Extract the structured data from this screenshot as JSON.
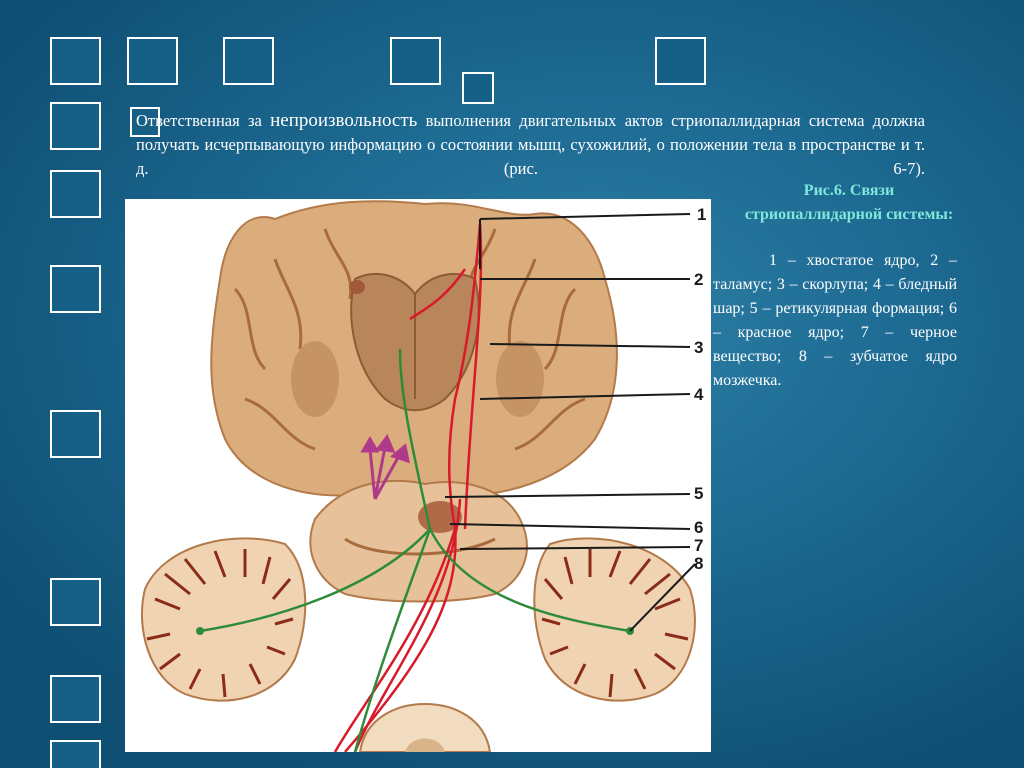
{
  "slide": {
    "paragraph": {
      "part1": "Ответственная за ",
      "emphasis": "непроизвольность",
      "part2": " выполнения двигательных актов стриопаллидарная система должна получать исчерпывающую информацию о состоянии мышц, сухожилий, о положении тела в пространстве и т. д. (рис. 6-7)."
    },
    "caption": {
      "title": "Рис.6. Связи стриопаллидарной системы:",
      "body": "1 – хвостатое ядро, 2 – таламус; 3 – скорлупа; 4 – бледный шар; 5 – ретикулярная формация; 6 – красное ядро; 7 – черное вещество; 8 – зубчатое ядро мозжечка."
    },
    "figure": {
      "labels": [
        "1",
        "2",
        "3",
        "4",
        "5",
        "6",
        "7",
        "8"
      ]
    },
    "colors": {
      "background": "#1d6a92",
      "caption_title": "#7fe8d8",
      "red_pathway": "#d81a2a",
      "green_pathway": "#2e8b3a",
      "tissue": "#d9a878",
      "nuclei": "#9a6a42"
    }
  }
}
